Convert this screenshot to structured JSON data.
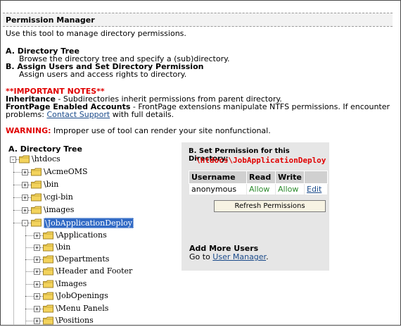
{
  "header": {
    "title": "Permission Manager"
  },
  "intro": "Use this tool to manage directory permissions.",
  "steps": [
    {
      "title": "A. Directory Tree",
      "desc": "Browse the directory tree and specify a (sub)directory."
    },
    {
      "title": "B. Assign Users and Set Directory Permission",
      "desc": "Assign users and access rights to directory."
    }
  ],
  "notes": {
    "heading": "**IMPORTANT NOTES**",
    "inheritance_label": "Inheritance",
    "inheritance_text": " - Subdirectories inherit permissions from parent directory.",
    "frontpage_label": "FrontPage Enabled Accounts",
    "frontpage_text": " - FrontPage extensions manipulate NTFS permissions. If encounter",
    "frontpage_text2_pre": "problems: ",
    "contact_link": "Contact Support",
    "frontpage_text2_post": " with full details."
  },
  "warning": {
    "label": "WARNING:",
    "text": " Improper use of tool can render your site nonfunctional."
  },
  "tree": {
    "title": "A. Directory Tree",
    "root": "\\htdocs",
    "level1": [
      "\\AcmeOMS",
      "\\bin",
      "\\cgi-bin",
      "\\images",
      "\\JobApplicationDeploy"
    ],
    "level2": [
      "\\Applications",
      "\\bin",
      "\\Departments",
      "\\Header and Footer",
      "\\Images",
      "\\JobOpenings",
      "\\Menu Panels",
      "\\Positions"
    ]
  },
  "permissions": {
    "title": "B. Set Permission for this Directory:",
    "path": "\\htdocs\\JobApplicationDeploy",
    "columns": [
      "Username",
      "Read",
      "Write"
    ],
    "rows": [
      {
        "username": "anonymous",
        "read": "Allow",
        "write": "Allow",
        "edit": "Edit"
      }
    ],
    "refresh_button": "Refresh Permissions",
    "add_users_title": "Add More Users",
    "go_to_text": "Go to ",
    "user_manager_link": "User Manager",
    "go_to_suffix": "."
  },
  "colors": {
    "red": "#e00000",
    "selected": "#316ac5",
    "panel": "#e6e6e6",
    "allow": "#2e8b2e"
  },
  "icons": {
    "folder": "folder-icon",
    "expand": "plus-expander-icon",
    "collapse": "minus-expander-icon"
  }
}
